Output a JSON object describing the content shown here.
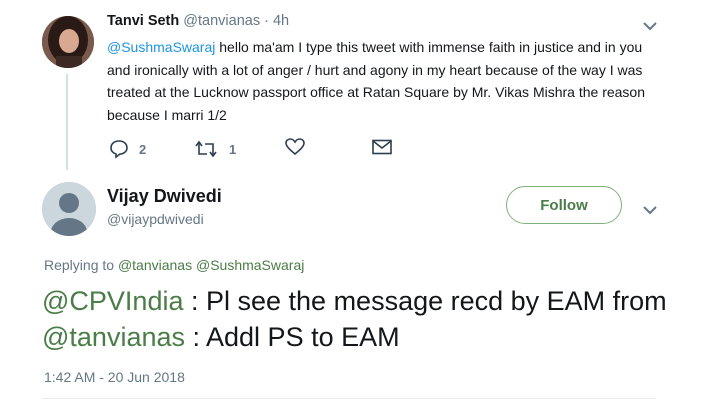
{
  "parent_tweet": {
    "author_name": "Tanvi Seth",
    "author_handle": "@tanvianas",
    "time_sep": " · ",
    "time": "4h",
    "mention": "@SushmaSwaraj",
    "text": " hello ma'am I type this tweet with immense faith in justice and in you and ironically with a lot of anger / hurt and agony in my heart because of the way I was treated at the Lucknow passport office at Ratan Square by Mr. Vikas Mishra the reason because I marri 1/2",
    "reply_count": "2",
    "retweet_count": "1"
  },
  "reply_tweet": {
    "author_name": "Vijay Dwivedi",
    "author_handle": "@vijaypdwivedi",
    "follow_label": "Follow",
    "replying_prefix": "Replying to ",
    "replying_to_1": "@tanvianas",
    "replying_to_2": "@SushmaSwaraj",
    "mention_1": "@CPVIndia",
    "text_1": " : Pl see the message recd by EAM from ",
    "mention_2": "@tanvianas",
    "text_2": " : Addl PS to EAM",
    "timestamp": "1:42 AM - 20 Jun 2018"
  },
  "colors": {
    "link_blue": "#1b95e0",
    "link_green": "#4a7d47",
    "muted": "#657786"
  },
  "icons": [
    "reply-icon",
    "retweet-icon",
    "like-icon",
    "message-icon",
    "chevron-down-icon"
  ]
}
